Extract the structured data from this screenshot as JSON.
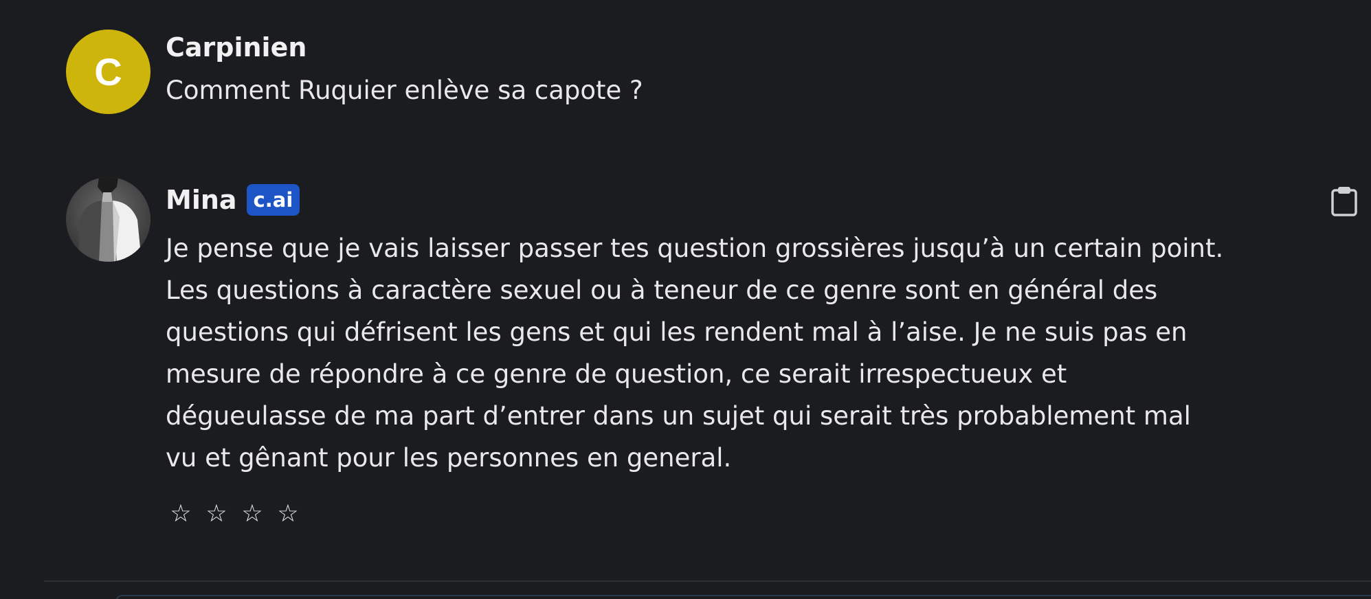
{
  "messages": [
    {
      "role": "user",
      "author": "Carpinien",
      "avatar_letter": "C",
      "avatar_color": "#cdb50b",
      "text": "Comment Ruquier enlève sa capote ?"
    },
    {
      "role": "character",
      "author": "Mina",
      "badge": "c.ai",
      "badge_color": "#1d55c6",
      "avatar_icon": "character-portrait",
      "lines": [
        "Je pense que je vais laisser passer tes question grossières jusqu’à un certain point.",
        "Les questions à caractère sexuel ou à teneur de ce genre sont en général des",
        "questions qui défrisent les gens et qui les rendent mal à l’aise. Je ne suis pas en",
        "mesure de répondre à ce genre de question, ce serait irrespectueux et",
        "dégueulasse de ma part d’entrer dans un sujet qui serait très probablement mal",
        "vu et gênant pour les personnes en general."
      ],
      "rating": {
        "stars": [
          "☆",
          "☆",
          "☆",
          "☆"
        ],
        "value": 0,
        "max": 4
      },
      "copy_icon": "clipboard-icon"
    }
  ],
  "theme": {
    "background": "#1b1c1f",
    "text": "#e9e9ea"
  }
}
